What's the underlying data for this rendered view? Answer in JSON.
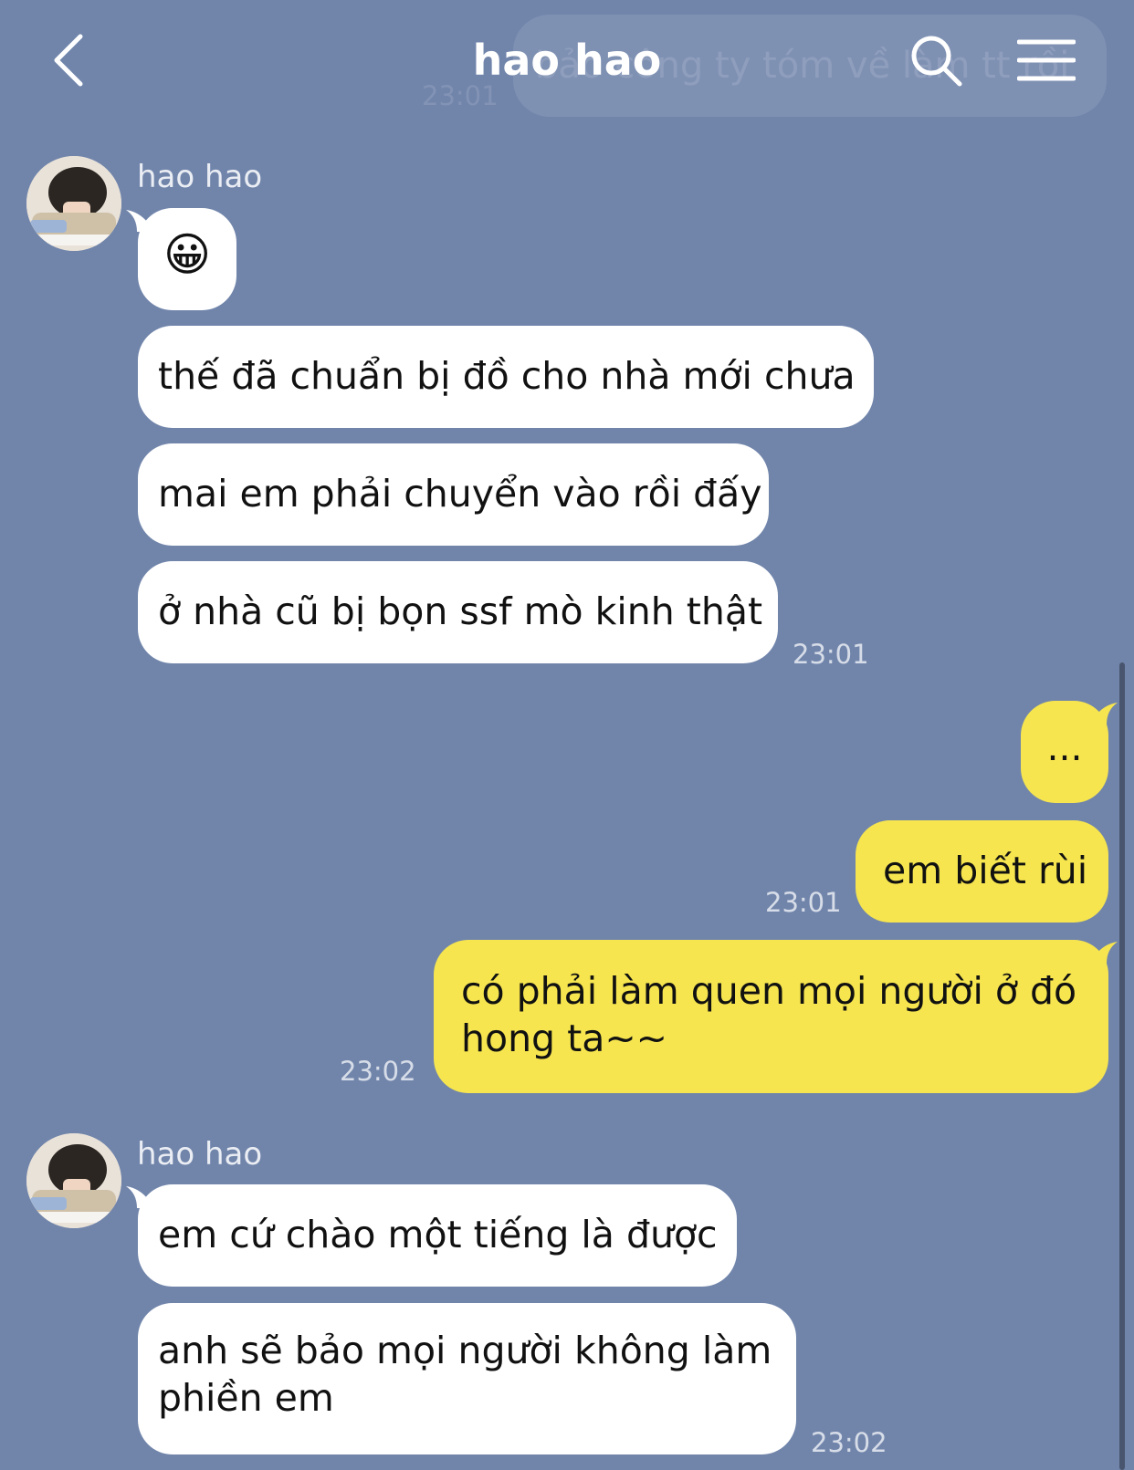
{
  "header": {
    "title": "hao hao",
    "back_icon": "chevron-left-icon",
    "search_icon": "search-icon",
    "menu_icon": "hamburger-menu-icon"
  },
  "ghost": {
    "text": "bảo công ty tóm về làm tt rồi",
    "time": "23:01"
  },
  "groups": [
    {
      "sender": "hao hao",
      "messages": [
        "😀",
        "thế đã chuẩn bị đồ cho nhà mới chưa",
        "mai em phải chuyển vào rồi đấy",
        "ở nhà cũ bị bọn ssf mò kinh thật"
      ],
      "time": "23:01"
    },
    {
      "sender": "me",
      "messages": [
        "...",
        "em biết rùi",
        "có phải làm quen mọi người ở đó hong ta~~"
      ],
      "times": [
        "23:01",
        "23:02"
      ]
    },
    {
      "sender": "hao hao",
      "messages": [
        "em cứ chào một tiếng là được",
        "anh sẽ bảo mọi người không làm phiền em"
      ],
      "time": "23:02"
    }
  ],
  "colors": {
    "background": "#7185ab",
    "incoming_bubble": "#ffffff",
    "outgoing_bubble": "#f6e54f"
  }
}
